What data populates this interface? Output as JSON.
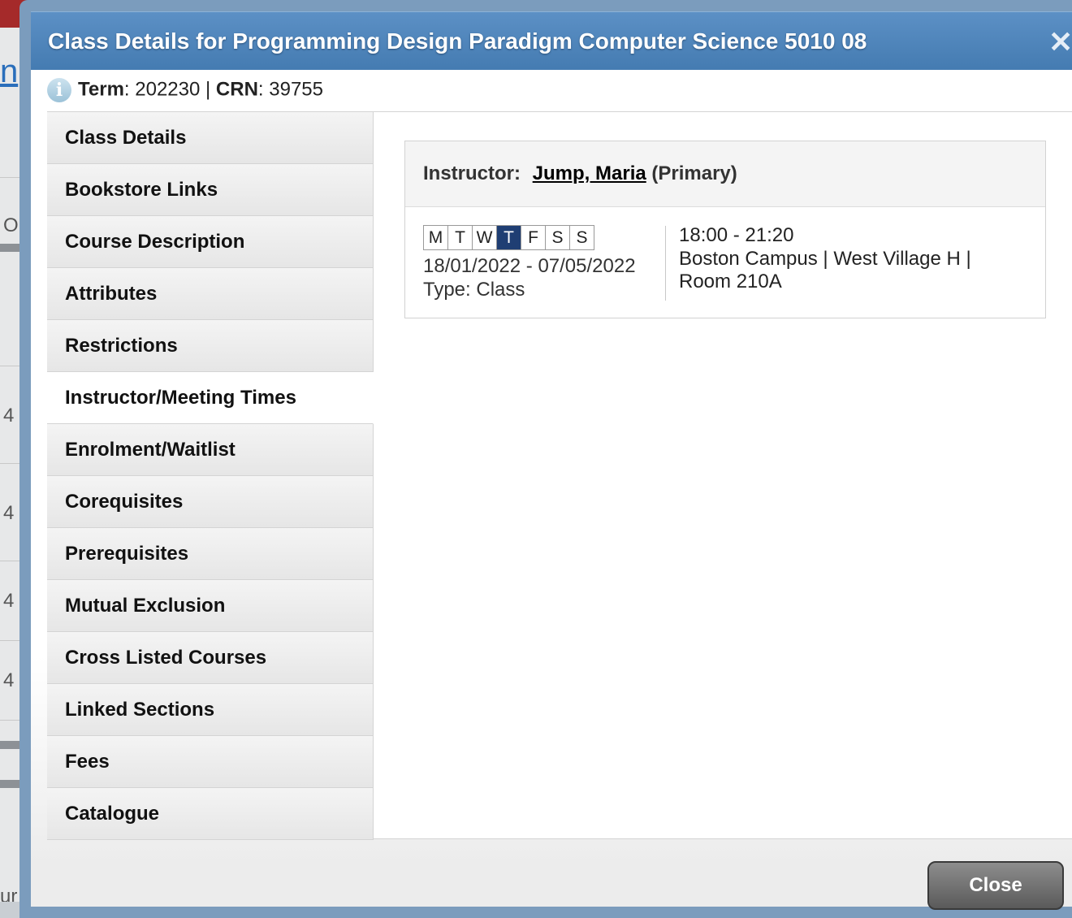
{
  "background": {
    "link_fragment": "n",
    "letters": [
      "O",
      "4",
      "4",
      "4",
      "4",
      "ur"
    ]
  },
  "dialog": {
    "title": "Class Details for Programming Design Paradigm Computer Science 5010 08",
    "close_icon": "close-icon",
    "term_label": "Term",
    "term_value": ": 202230 | ",
    "crn_label": "CRN",
    "crn_value": ": 39755"
  },
  "tabs": [
    {
      "label": "Class Details",
      "active": false
    },
    {
      "label": "Bookstore Links",
      "active": false
    },
    {
      "label": "Course Description",
      "active": false
    },
    {
      "label": "Attributes",
      "active": false
    },
    {
      "label": "Restrictions",
      "active": false
    },
    {
      "label": "Instructor/Meeting Times",
      "active": true
    },
    {
      "label": "Enrolment/Waitlist",
      "active": false
    },
    {
      "label": "Corequisites",
      "active": false
    },
    {
      "label": "Prerequisites",
      "active": false
    },
    {
      "label": "Mutual Exclusion",
      "active": false
    },
    {
      "label": "Cross Listed Courses",
      "active": false
    },
    {
      "label": "Linked Sections",
      "active": false
    },
    {
      "label": "Fees",
      "active": false
    },
    {
      "label": "Catalogue",
      "active": false
    }
  ],
  "meeting": {
    "instructor_label": "Instructor:",
    "instructor_name": "Jump, Maria",
    "instructor_role": "(Primary)",
    "days": [
      {
        "letter": "M",
        "on": false
      },
      {
        "letter": "T",
        "on": false
      },
      {
        "letter": "W",
        "on": false
      },
      {
        "letter": "T",
        "on": true
      },
      {
        "letter": "F",
        "on": false
      },
      {
        "letter": "S",
        "on": false
      },
      {
        "letter": "S",
        "on": false
      }
    ],
    "date_range": "18/01/2022 - 07/05/2022",
    "type": "Type: Class",
    "time": "18:00 - 21:20",
    "location": "Boston Campus | West Village H | Room 210A"
  },
  "footer": {
    "close_label": "Close"
  },
  "colors": {
    "title_bar": "#4f86bd",
    "active_day": "#1f3e73",
    "close_button": "#707070"
  }
}
